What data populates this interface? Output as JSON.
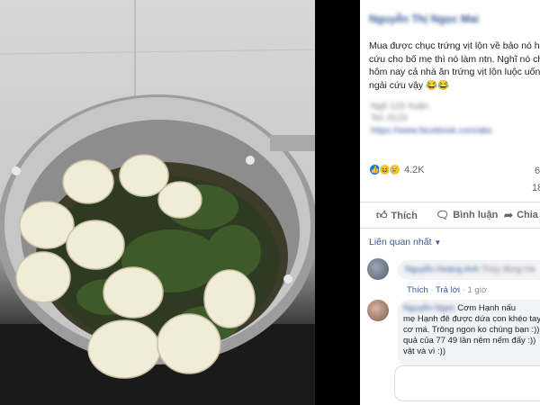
{
  "post": {
    "author_blurred": "Nguyễn Thị Ngọc Mai",
    "text_lines": [
      "Mua được chục trứng vịt lộn về bảo nó h",
      "cứu cho bố mẹ thì nó làm ntn. Nghĩ nó ch",
      "hôm nay cả nhà ăn trứng vịt lộn luộc uốn",
      "ngải cứu vậy 😂😂"
    ],
    "blurred_lines": [
      "Ngõ 123 Xuân",
      "Tel: 0123",
      "https://www.facebook.com/abc"
    ],
    "reactions": {
      "like_icon": "like-icon",
      "haha_icon": "haha-icon",
      "sad_icon": "sad-icon",
      "count": "4.2K"
    },
    "right_count_1": "6",
    "right_count_2": "18"
  },
  "actions": {
    "like_label": "Thích",
    "comment_label": "Bình luận",
    "share_label": "Chia"
  },
  "related_label": "Liên quan nhất",
  "comments": [
    {
      "author_blurred": "Nguyễn Hoàng Anh",
      "text_blurred": "Thủy đúng Hà",
      "actions": [
        "Thích",
        "Trả lời"
      ],
      "time": "1 giờ"
    },
    {
      "author_blurred": "Nguyễn Ngọc",
      "lines": [
        "Cơm Hạnh nấu",
        "mẹ Hạnh đê được dứa con khéo tay",
        "cơ má. Trông ngon ko chúng bạn :))",
        "quả của 77 49 lần nêm nếm đấy :))",
        "vật và vì :))"
      ]
    }
  ]
}
